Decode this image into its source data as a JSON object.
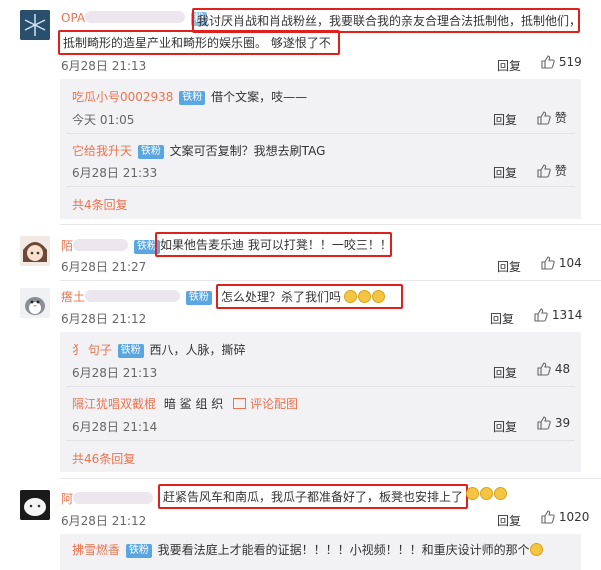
{
  "comments": [
    {
      "name": "OPA",
      "badge": "粉",
      "text1": "我讨厌肖战和肖战粉丝，我要联合我的亲友合理合法抵制他，抵制他们，",
      "text2": "抵制畸形的造星产业和畸形的娱乐圈。 够遂恨了不",
      "time": "6月28日 21:13",
      "reply": "回复",
      "likes": "519",
      "replies": [
        {
          "name": "吃瓜小号0002938",
          "badge": "铁粉",
          "text": "借个文案，吱——",
          "time": "今天 01:05",
          "reply": "回复",
          "likes": "赞"
        },
        {
          "name": "它给我升天",
          "badge": "铁粉",
          "text": "文案可否复制？我想去刷TAG",
          "time": "6月28日 21:33",
          "reply": "回复",
          "likes": "赞"
        }
      ],
      "more": "共4条回复"
    },
    {
      "name": "陌",
      "badge": "铁粉",
      "text": "如果他告麦乐迪 我可以打凳！！一咬三！！",
      "time": "6月28日 21:27",
      "reply": "回复",
      "likes": "104"
    },
    {
      "name": "瘩土",
      "badge": "铁粉",
      "text": "怎么处理？杀了我们吗",
      "time": "6月28日 21:12",
      "reply": "回复",
      "likes": "1314",
      "replies": [
        {
          "name": "犭 句子",
          "badge": "铁粉",
          "text": "西八，人脉，撕碎",
          "time": "6月28日 21:13",
          "reply": "回复",
          "likes": "48"
        },
        {
          "name": "隔江犹唱双截棍",
          "badge": "",
          "text": "暗 鲨 组 织",
          "extra": "评论配图",
          "time": "6月28日 21:14",
          "reply": "回复",
          "likes": "39"
        }
      ],
      "more": "共46条回复"
    },
    {
      "name": "阿",
      "badge": "",
      "text": "赶紧告风车和南瓜，我瓜子都准备好了，板凳也安排上了",
      "time": "6月28日 21:12",
      "reply": "回复",
      "likes": "1020",
      "replies": [
        {
          "name": "拂雪燃香",
          "badge": "铁粉",
          "text": "我要看法庭上才能看的证据！！！！小视频！！！和重庆设计师的那个"
        }
      ]
    }
  ]
}
